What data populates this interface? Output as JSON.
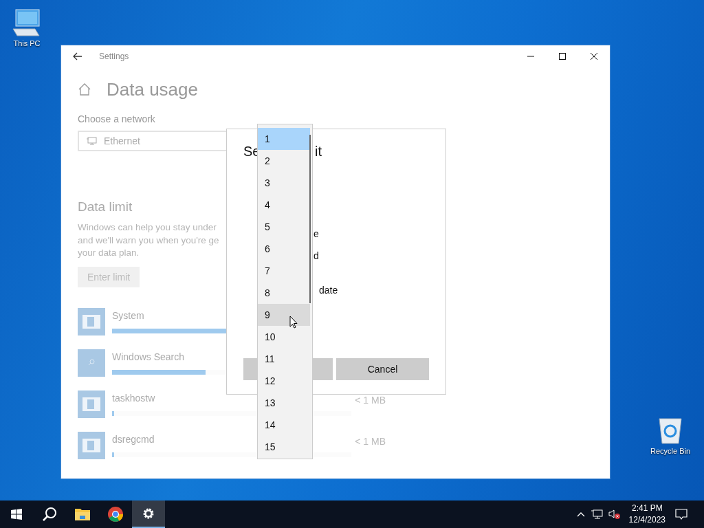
{
  "desktop_icons": [
    {
      "label": "This PC",
      "kind": "computer"
    },
    {
      "label": "Recycle Bin",
      "kind": "recycle"
    }
  ],
  "window": {
    "title": "Settings",
    "page_title": "Data usage",
    "network": {
      "label": "Choose a network",
      "value": "Ethernet"
    },
    "data_limit": {
      "heading": "Data limit",
      "text_lines": [
        "Windows can help you stay under",
        "and we'll warn you when you're ge",
        "your data plan."
      ],
      "button": "Enter limit"
    },
    "apps": [
      {
        "name": "System",
        "kind": "app",
        "level": 1.0
      },
      {
        "name": "Windows Search",
        "kind": "search",
        "level": 0.39
      },
      {
        "name": "taskhostw",
        "kind": "app",
        "level": 0.01,
        "usage": "< 1 MB"
      },
      {
        "name": "dsregcmd",
        "kind": "app",
        "level": 0.01,
        "usage": "< 1 MB"
      }
    ]
  },
  "dialog": {
    "title_start": "Se",
    "title_end": "it",
    "text_fragments": [
      "e",
      "d",
      "date"
    ],
    "buttons": [
      {
        "label": "Cancel"
      }
    ]
  },
  "dropdown": {
    "items": [
      {
        "label": "1",
        "selected": true,
        "hovered": false
      },
      {
        "label": "2",
        "selected": false,
        "hovered": false
      },
      {
        "label": "3",
        "selected": false,
        "hovered": false
      },
      {
        "label": "4",
        "selected": false,
        "hovered": false
      },
      {
        "label": "5",
        "selected": false,
        "hovered": false
      },
      {
        "label": "6",
        "selected": false,
        "hovered": false
      },
      {
        "label": "7",
        "selected": false,
        "hovered": false
      },
      {
        "label": "8",
        "selected": false,
        "hovered": false
      },
      {
        "label": "9",
        "selected": false,
        "hovered": true
      },
      {
        "label": "10",
        "selected": false,
        "hovered": false
      },
      {
        "label": "11",
        "selected": false,
        "hovered": false
      },
      {
        "label": "12",
        "selected": false,
        "hovered": false
      },
      {
        "label": "13",
        "selected": false,
        "hovered": false
      },
      {
        "label": "14",
        "selected": false,
        "hovered": false
      },
      {
        "label": "15",
        "selected": false,
        "hovered": false
      }
    ]
  },
  "taskbar": {
    "apps": [
      {
        "kind": "search",
        "active": false
      },
      {
        "kind": "folder",
        "active": false
      },
      {
        "kind": "browser",
        "active": false
      },
      {
        "kind": "settings",
        "active": true
      }
    ],
    "time": "2:41 PM",
    "date": "12/4/2023"
  }
}
